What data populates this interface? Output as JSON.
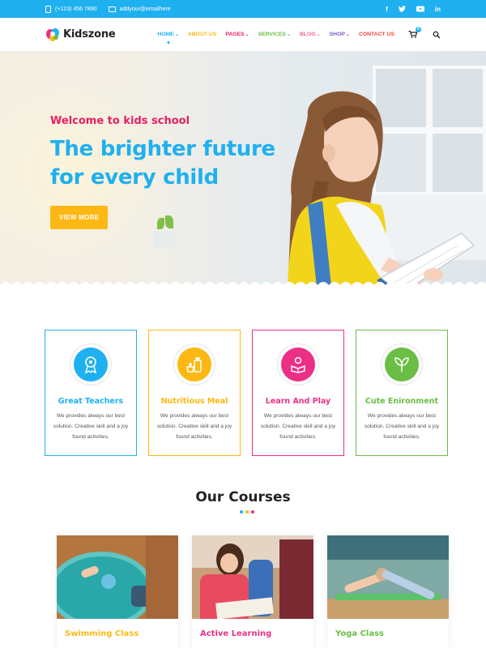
{
  "topbar": {
    "phone": "(+123) 456 7890",
    "email": "addyour@emailhere",
    "social": [
      "f",
      "t",
      "yt",
      "in"
    ]
  },
  "header": {
    "logo_text": "Kidszone",
    "nav": [
      {
        "label": "HOME",
        "color": "#1fb0ef",
        "dropdown": true
      },
      {
        "label": "ABOUT US",
        "color": "#fdb813",
        "dropdown": false
      },
      {
        "label": "PAGES",
        "color": "#e91e63",
        "dropdown": true
      },
      {
        "label": "SERVICES",
        "color": "#6abd45",
        "dropdown": true
      },
      {
        "label": "BLOG",
        "color": "#f06292",
        "dropdown": true
      },
      {
        "label": "SHOP",
        "color": "#7e57c2",
        "dropdown": true
      },
      {
        "label": "CONTACT US",
        "color": "#f44336",
        "dropdown": false
      }
    ],
    "cart_count": "0",
    "cart_icon": "cart-icon",
    "search_icon": "search-icon"
  },
  "hero": {
    "subtitle": "Welcome to kids school",
    "title_line1": "The brighter future",
    "title_line2": "for every child",
    "button": "VIEW MORE"
  },
  "features": [
    {
      "title": "Great Teachers",
      "color": "#1fb0ef",
      "icon": "award-ribbon-icon",
      "desc": "We provides always our best solution. Creative skill and a joy found activities."
    },
    {
      "title": "Nutritious Meal",
      "color": "#fdb813",
      "icon": "meal-bottle-icon",
      "desc": "We provides always our best solution. Creative skill and a joy found activities."
    },
    {
      "title": "Learn And Play",
      "color": "#ec2f86",
      "icon": "reading-child-icon",
      "desc": "We provides always our best solution. Creative skill and a joy found activities."
    },
    {
      "title": "Cute Enironment",
      "color": "#6abd45",
      "icon": "leaf-icon",
      "desc": "We provides always our best solution. Creative skill and a joy found activities."
    }
  ],
  "courses": {
    "title": "Our Courses",
    "items": [
      {
        "name": "Swimming Class",
        "color": "#fdb813"
      },
      {
        "name": "Active Learning",
        "color": "#ec2f86"
      },
      {
        "name": "Yoga Class",
        "color": "#6abd45"
      }
    ]
  }
}
